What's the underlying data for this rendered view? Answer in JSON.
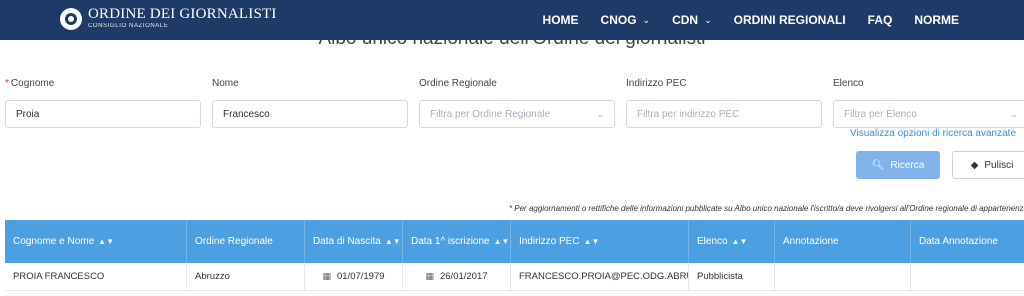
{
  "header": {
    "logo_title": "ORDINE DEI GIORNALISTI",
    "logo_subtitle": "CONSIGLIO NAZIONALE",
    "nav": [
      {
        "label": "HOME"
      },
      {
        "label": "CNOG",
        "dropdown": true
      },
      {
        "label": "CDN",
        "dropdown": true
      },
      {
        "label": "ORDINI REGIONALI"
      },
      {
        "label": "FAQ"
      },
      {
        "label": "NORME"
      }
    ],
    "background_color": "#1e3a67"
  },
  "page": {
    "heading": "Albo unico nazionale dell'Ordine dei giornalisti"
  },
  "form": {
    "cognome": {
      "label": "Cognome",
      "required_mark": "*",
      "value": "Proia"
    },
    "nome": {
      "label": "Nome",
      "value": "Francesco"
    },
    "ordine_regionale": {
      "label": "Ordine Regionale",
      "placeholder": "Filtra per Ordine Regionale"
    },
    "indirizzo_pec": {
      "label": "Indirizzo PEC",
      "placeholder": "Filtra per indirizzo PEC"
    },
    "elenco": {
      "label": "Elenco",
      "placeholder": "Filtra per Elenco"
    },
    "advanced_link": "Visualizza opzioni di ricerca avanzate",
    "search_button": "Ricerca",
    "clear_button": "Pulisci"
  },
  "note": "* Per aggiornamenti o rettifiche delle informazioni pubblicate su Albo unico nazionale l'iscritto/a deve rivolgersi all'Ordine regionale di appartenenza",
  "table": {
    "columns": [
      {
        "label": "Cognome e Nome",
        "sortable": true
      },
      {
        "label": "Ordine Regionale",
        "sortable": false
      },
      {
        "label": "Data di Nascita",
        "sortable": true
      },
      {
        "label": "Data 1^ iscrizione",
        "sortable": true
      },
      {
        "label": "Indirizzo PEC",
        "sortable": true
      },
      {
        "label": "Elenco",
        "sortable": true
      },
      {
        "label": "Annotazione",
        "sortable": false
      },
      {
        "label": "Data Annotazione",
        "sortable": false
      }
    ],
    "rows": [
      {
        "nome": "PROIA FRANCESCO",
        "ordine": "Abruzzo",
        "nascita": "01/07/1979",
        "iscrizione": "26/01/2017",
        "pec": "FRANCESCO.PROIA@PEC.ODG.ABRU...",
        "elenco": "Pubblicista",
        "annotazione": "",
        "data_annotazione": ""
      }
    ],
    "header_color": "#4c9fe0"
  }
}
